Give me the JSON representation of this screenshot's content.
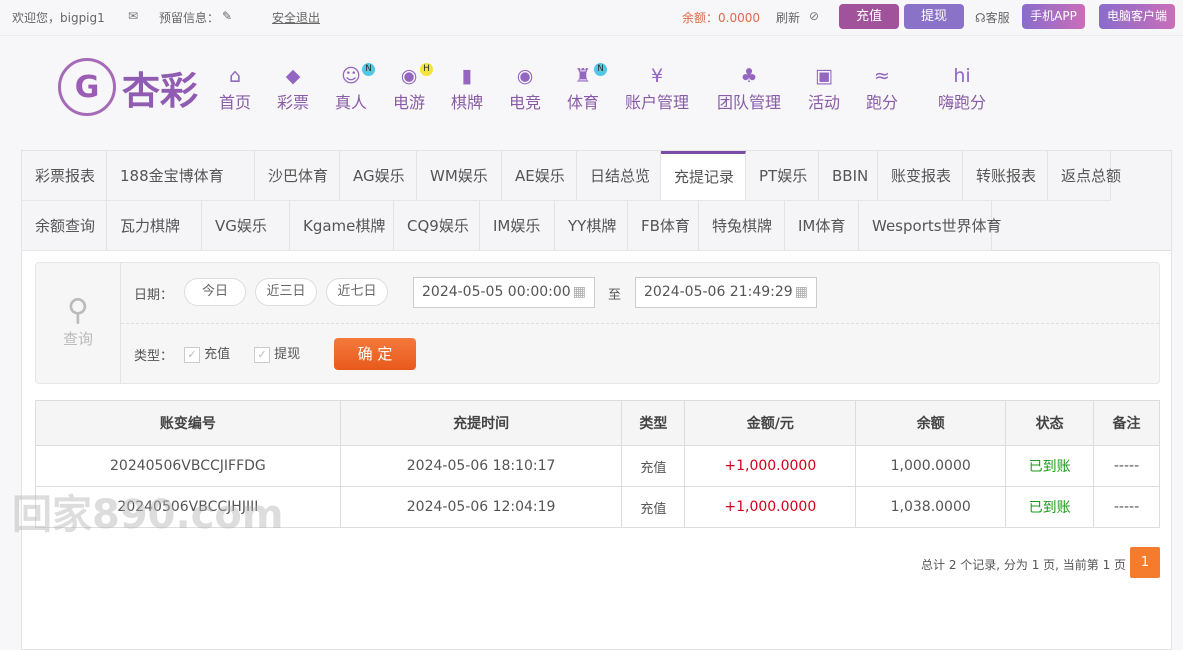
{
  "topbar": {
    "welcome": "欢迎您，bigpig1",
    "reserve_label": "预留信息：",
    "logout": "安全退出",
    "balance": "余额：0.0000",
    "refresh": "刷新",
    "deposit": "充值",
    "withdraw": "提现",
    "support": "客服",
    "mobile_app": "手机APP",
    "pc_client": "电脑客户端"
  },
  "logo": {
    "text": "杏彩"
  },
  "nav": [
    {
      "label": "首页",
      "icon": "home-icon"
    },
    {
      "label": "彩票",
      "icon": "ticket-icon"
    },
    {
      "label": "真人",
      "icon": "lady-icon",
      "badge": "N"
    },
    {
      "label": "电游",
      "icon": "gamepad-icon",
      "badge": "H"
    },
    {
      "label": "棋牌",
      "icon": "cards-icon"
    },
    {
      "label": "电竞",
      "icon": "gamepad-icon"
    },
    {
      "label": "体育",
      "icon": "trophy-icon",
      "badge": "N"
    },
    {
      "label": "账户管理",
      "icon": "yen-icon"
    },
    {
      "label": "团队管理",
      "icon": "team-icon"
    },
    {
      "label": "活动",
      "icon": "gift-icon"
    },
    {
      "label": "跑分",
      "icon": "rhino-icon"
    },
    {
      "label": "嗨跑分",
      "icon": "hi-icon"
    }
  ],
  "tabs_row1": [
    "彩票报表",
    "188金宝博体育",
    "沙巴体育",
    "AG娱乐",
    "WM娱乐",
    "AE娱乐",
    "日结总览",
    "充提记录",
    "PT娱乐",
    "BBIN",
    "账变报表",
    "转账报表",
    "返点总额"
  ],
  "tabs_row2": [
    "余额查询",
    "瓦力棋牌",
    "VG娱乐",
    "Kgame棋牌",
    "CQ9娱乐",
    "IM娱乐",
    "YY棋牌",
    "FB体育",
    "特兔棋牌",
    "IM体育",
    "Wesports世界体育"
  ],
  "active_tab": "充提记录",
  "filter": {
    "query": "查询",
    "date_label": "日期：",
    "today": "今日",
    "three_days": "近三日",
    "seven_days": "近七日",
    "start": "2024-05-05 00:00:00",
    "to": "至",
    "end": "2024-05-06 21:49:29",
    "type_label": "类型：",
    "deposit": "充值",
    "withdraw": "提现",
    "confirm": "确 定"
  },
  "table": {
    "headers": [
      "账变编号",
      "充提时间",
      "类型",
      "金额/元",
      "余额",
      "状态",
      "备注"
    ],
    "rows": [
      [
        "20240506VBCCJIFFDG",
        "2024-05-06 18:10:17",
        "充值",
        "+1,000.0000",
        "1,000.0000",
        "已到账",
        "-----"
      ],
      [
        "20240506VBCCJHJIII",
        "2024-05-06 12:04:19",
        "充值",
        "+1,000.0000",
        "1,038.0000",
        "已到账",
        "-----"
      ]
    ]
  },
  "pagination": {
    "summary": "总计 2 个记录, 分为 1 页, 当前第 1 页",
    "page": "1"
  },
  "watermark": "回家890.com"
}
